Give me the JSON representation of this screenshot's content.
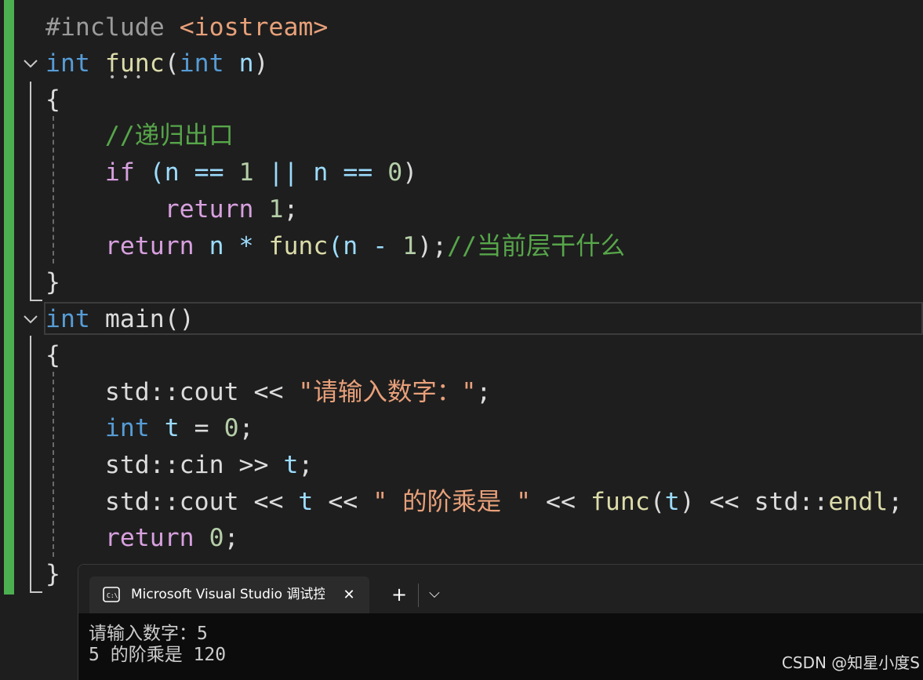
{
  "editor": {
    "lines": [
      {
        "tokens": [
          {
            "t": "#include ",
            "c": "pp"
          },
          {
            "t": "<iostream>",
            "c": "inc"
          }
        ]
      },
      {
        "tokens": [
          {
            "t": "int",
            "c": "kw"
          },
          {
            "t": " ",
            "c": "pl"
          },
          {
            "t": "func",
            "c": "fn"
          },
          {
            "t": "(",
            "c": "pl"
          },
          {
            "t": "int",
            "c": "kw"
          },
          {
            "t": " n",
            "c": "par"
          },
          {
            "t": ")",
            "c": "pl"
          }
        ]
      },
      {
        "tokens": [
          {
            "t": "{",
            "c": "pl"
          }
        ]
      },
      {
        "tokens": [
          {
            "t": "    //递归出口",
            "c": "cm"
          }
        ]
      },
      {
        "tokens": [
          {
            "t": "    ",
            "c": "pl"
          },
          {
            "t": "if",
            "c": "ctl"
          },
          {
            "t": " (n == ",
            "c": "par"
          },
          {
            "t": "1",
            "c": "num"
          },
          {
            "t": " || n == ",
            "c": "par"
          },
          {
            "t": "0",
            "c": "num"
          },
          {
            "t": ")",
            "c": "pl"
          }
        ]
      },
      {
        "tokens": [
          {
            "t": "        ",
            "c": "pl"
          },
          {
            "t": "return",
            "c": "ctl"
          },
          {
            "t": " ",
            "c": "pl"
          },
          {
            "t": "1",
            "c": "num"
          },
          {
            "t": ";",
            "c": "pl"
          }
        ]
      },
      {
        "tokens": [
          {
            "t": "    ",
            "c": "pl"
          },
          {
            "t": "return",
            "c": "ctl"
          },
          {
            "t": " n * ",
            "c": "par"
          },
          {
            "t": "func",
            "c": "fn"
          },
          {
            "t": "(n - ",
            "c": "par"
          },
          {
            "t": "1",
            "c": "num"
          },
          {
            "t": ");",
            "c": "pl"
          },
          {
            "t": "//当前层干什么",
            "c": "cm"
          }
        ]
      },
      {
        "tokens": [
          {
            "t": "}",
            "c": "pl"
          }
        ]
      },
      {
        "tokens": [
          {
            "t": "int",
            "c": "kw"
          },
          {
            "t": " main()",
            "c": "pl"
          }
        ]
      },
      {
        "tokens": [
          {
            "t": "{",
            "c": "pl"
          }
        ]
      },
      {
        "tokens": [
          {
            "t": "    std::cout << ",
            "c": "pl"
          },
          {
            "t": "\"请输入数字：\"",
            "c": "str"
          },
          {
            "t": ";",
            "c": "pl"
          }
        ]
      },
      {
        "tokens": [
          {
            "t": "    ",
            "c": "pl"
          },
          {
            "t": "int",
            "c": "kw"
          },
          {
            "t": " ",
            "c": "pl"
          },
          {
            "t": "t",
            "c": "var"
          },
          {
            "t": " = ",
            "c": "pl"
          },
          {
            "t": "0",
            "c": "num"
          },
          {
            "t": ";",
            "c": "pl"
          }
        ]
      },
      {
        "tokens": [
          {
            "t": "    std::cin >> ",
            "c": "pl"
          },
          {
            "t": "t",
            "c": "var"
          },
          {
            "t": ";",
            "c": "pl"
          }
        ]
      },
      {
        "tokens": [
          {
            "t": "    std::cout << ",
            "c": "pl"
          },
          {
            "t": "t",
            "c": "var"
          },
          {
            "t": " << ",
            "c": "pl"
          },
          {
            "t": "\" 的阶乘是 \"",
            "c": "str"
          },
          {
            "t": " << ",
            "c": "pl"
          },
          {
            "t": "func",
            "c": "fn"
          },
          {
            "t": "(",
            "c": "pl"
          },
          {
            "t": "t",
            "c": "var"
          },
          {
            "t": ") << std::",
            "c": "pl"
          },
          {
            "t": "endl",
            "c": "fn"
          },
          {
            "t": ";",
            "c": "pl"
          }
        ]
      },
      {
        "tokens": [
          {
            "t": "    ",
            "c": "pl"
          },
          {
            "t": "return",
            "c": "ctl"
          },
          {
            "t": " ",
            "c": "pl"
          },
          {
            "t": "0",
            "c": "num"
          },
          {
            "t": ";",
            "c": "pl"
          }
        ]
      },
      {
        "tokens": [
          {
            "t": "}",
            "c": "pl"
          }
        ]
      }
    ]
  },
  "terminal": {
    "tab_title": "Microsoft Visual Studio 调试控制台",
    "new_tab_glyph": "+",
    "dropdown_glyph": "⌵",
    "close_glyph": "✕",
    "output": [
      "请输入数字：5",
      "5 的阶乘是 120"
    ]
  },
  "watermark": "CSDN @知星小度S",
  "colors": {
    "editor_bg": "#1e1e1e",
    "change_bar": "#4caf50",
    "terminal_bg": "#0c0c0c",
    "tabbar_bg": "#202020"
  }
}
